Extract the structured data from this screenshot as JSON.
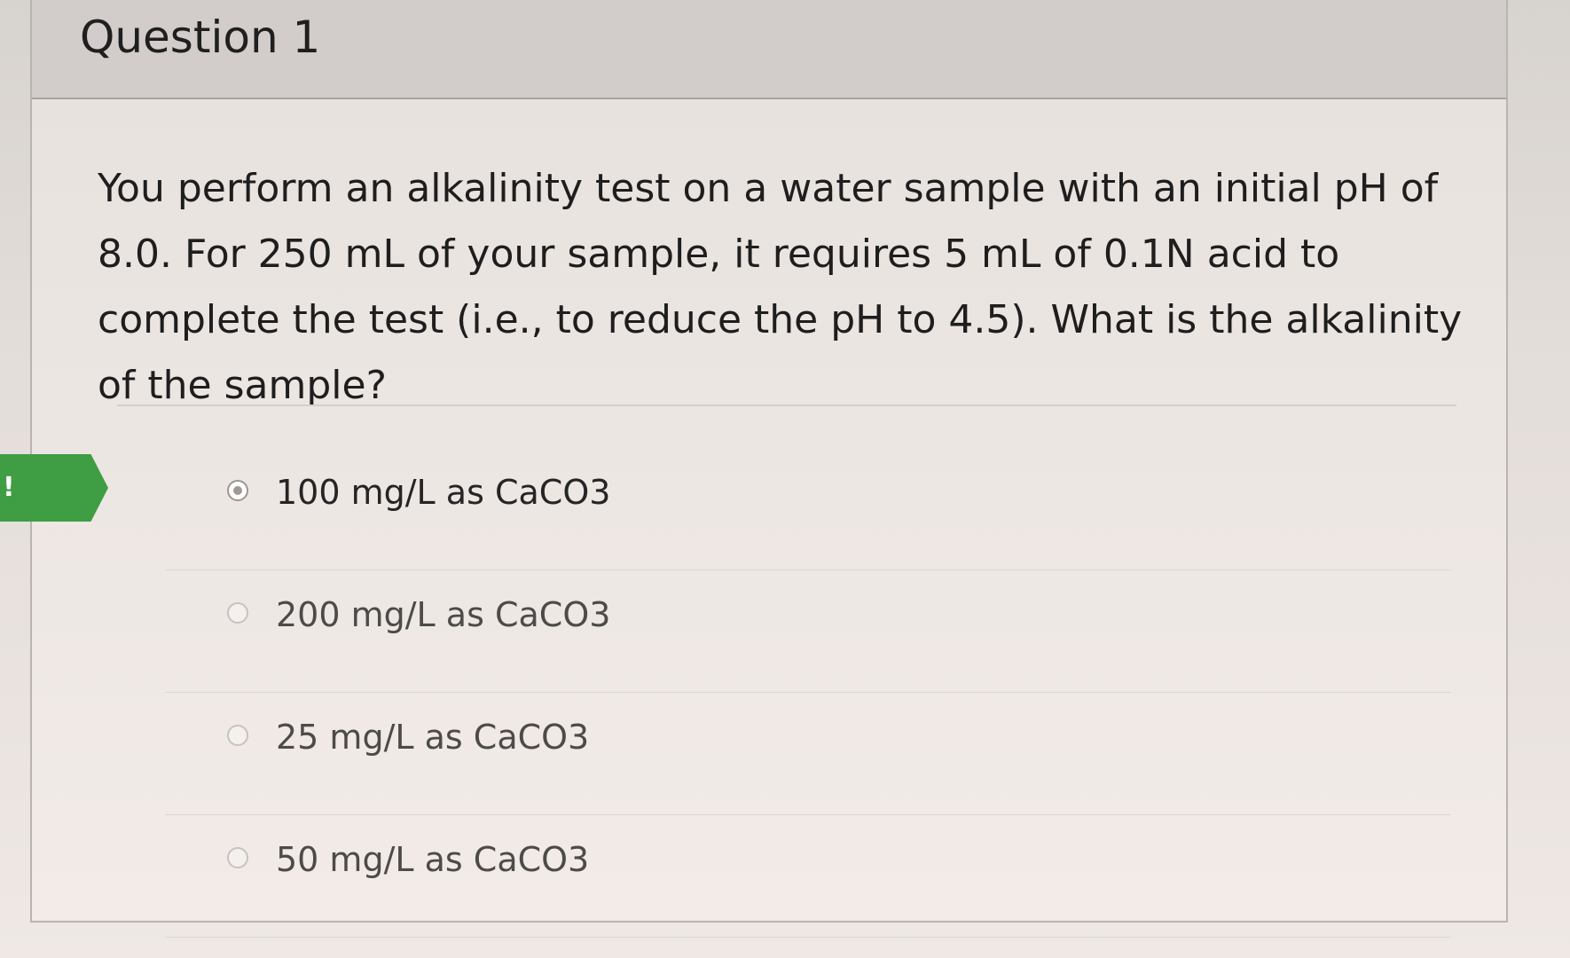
{
  "quiz": {
    "question_title": "Question 1",
    "question_text": "You perform an alkalinity test on a water sample with an initial pH of 8.0. For 250 mL of your sample, it requires 5 mL of 0.1N acid to complete the test (i.e., to reduce the pH to 4.5). What is the alkalinity of the sample?",
    "answers": [
      {
        "label": "100 mg/L as CaCO3",
        "selected": true
      },
      {
        "label": "200 mg/L as CaCO3",
        "selected": false
      },
      {
        "label": "25 mg/L as CaCO3",
        "selected": false
      },
      {
        "label": "50 mg/L as CaCO3",
        "selected": false
      }
    ]
  },
  "colors": {
    "selected_marker": "#3f9d43",
    "page_background": "#e6e1dd",
    "header_background": "#d2cdca",
    "text_primary": "#1e1e1e",
    "text_muted": "#4d4b49"
  },
  "icons": {
    "selected_marker": "selected-answer-marker-icon",
    "radio_selected": "radio-selected-icon",
    "radio_unselected": "radio-unselected-icon"
  }
}
